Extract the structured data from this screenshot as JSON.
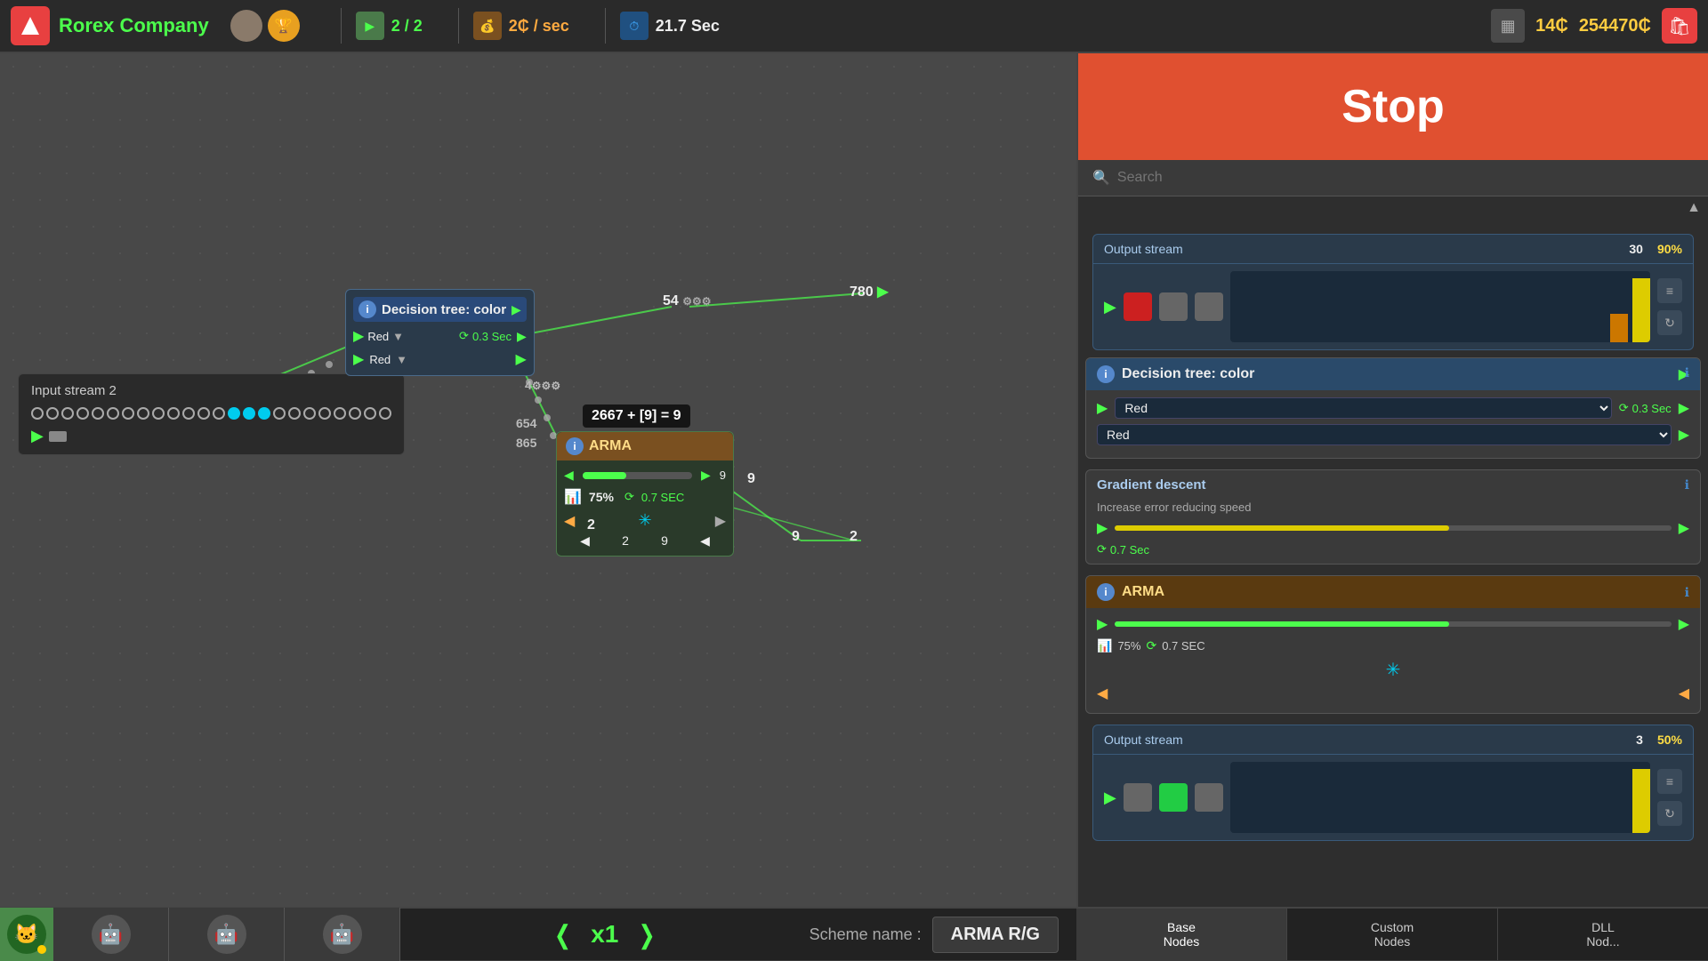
{
  "topbar": {
    "company": "Rorex Company",
    "queue": "2 / 2",
    "rate": "2₵ / sec",
    "time": "21.7 Sec",
    "currency_small": "14₵",
    "currency_large": "254470₵"
  },
  "stop_button": "Stop",
  "search_placeholder": "Search",
  "panel": {
    "decision_tree": {
      "title": "Decision tree: color",
      "output1_label": "Red",
      "output2_label": "Red",
      "speed": "0.3 Sec"
    },
    "gradient_descent": {
      "title": "Gradient descent",
      "desc": "Increase error reducing speed",
      "speed": "0.7 Sec"
    },
    "arma": {
      "title": "ARMA",
      "pct": "75%",
      "speed": "0.7 SEC"
    }
  },
  "output_stream_1": {
    "title": "Output stream",
    "count": "30",
    "pct": "90%"
  },
  "output_stream_2": {
    "title": "Output stream",
    "count": "3",
    "pct": "50%"
  },
  "canvas": {
    "decision_node": {
      "title": "Decision tree: color",
      "output1": "Red",
      "output2": "Red",
      "speed": "0.3 Sec",
      "num1": "54",
      "num2": "780"
    },
    "arma_node": {
      "title": "ARMA",
      "equation": "2667 + [9] = 9",
      "pct": "75%",
      "speed": "0.7 SEC",
      "num1": "654",
      "num2": "865",
      "num3": "9",
      "num4": "2",
      "num5": "9",
      "num6": "2"
    },
    "input_stream": {
      "title": "Input stream 2"
    }
  },
  "bottombar": {
    "speed": "x1",
    "scheme_label": "Scheme name :",
    "scheme_name": "ARMA R/G"
  },
  "tabs": {
    "base": "Base\nNodes",
    "custom": "Custom\nNodes",
    "dll": "DLL\nNod..."
  }
}
